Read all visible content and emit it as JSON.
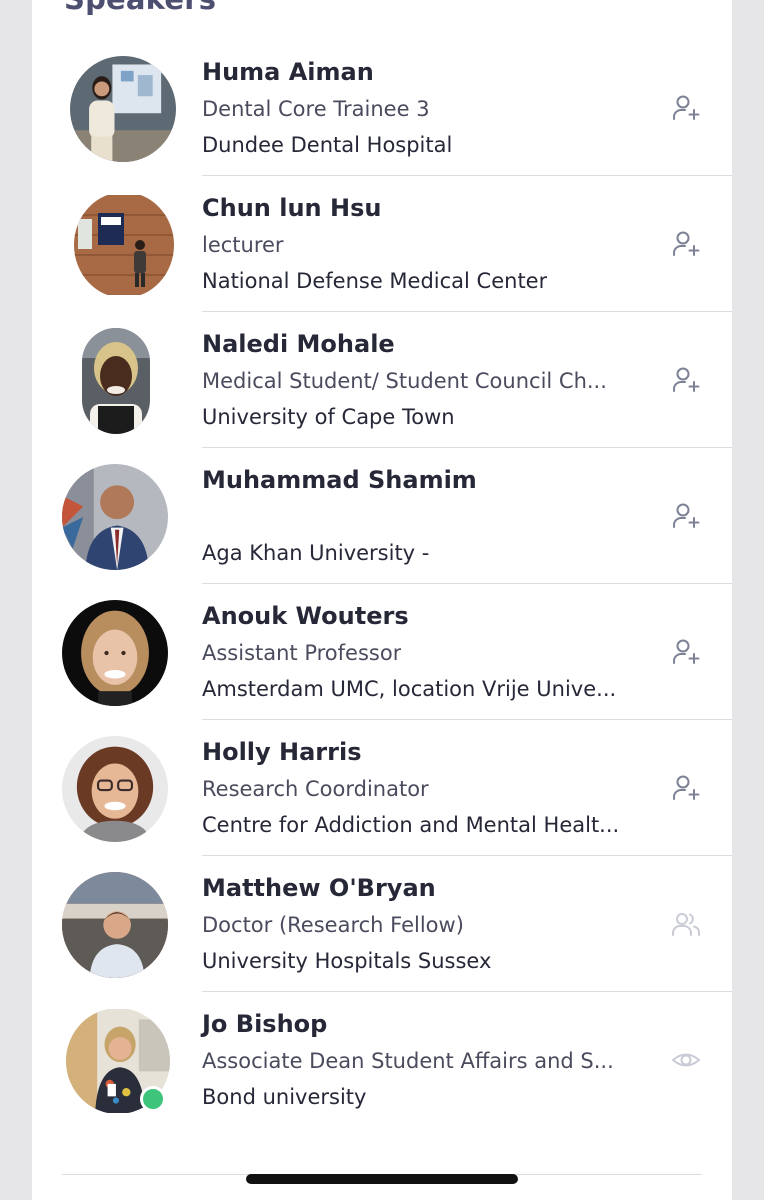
{
  "section": {
    "title": "Speakers"
  },
  "colors": {
    "accent": "#4d4f70",
    "icon": "#7c8196",
    "icon_muted": "#c9ccd6",
    "online": "#3ec47b"
  },
  "speakers": [
    {
      "name": "Huma Aiman",
      "title": "Dental Core Trainee 3",
      "org": "Dundee Dental Hospital",
      "action_icon": "add-contact-icon"
    },
    {
      "name": "Chun lun Hsu",
      "title": "lecturer",
      "org": "National Defense Medical Center",
      "action_icon": "add-contact-icon"
    },
    {
      "name": "Naledi Mohale",
      "title": "Medical Student/ Student Council Ch...",
      "org": "University of Cape Town",
      "action_icon": "add-contact-icon"
    },
    {
      "name": "Muhammad Shamim",
      "title": "",
      "org": "Aga Khan University -",
      "action_icon": "add-contact-icon"
    },
    {
      "name": "Anouk Wouters",
      "title": "Assistant Professor",
      "org": "Amsterdam UMC, location Vrije Unive...",
      "action_icon": "add-contact-icon"
    },
    {
      "name": "Holly Harris",
      "title": "Research Coordinator",
      "org": "Centre for Addiction and Mental Healt...",
      "action_icon": "add-contact-icon"
    },
    {
      "name": "Matthew O'Bryan",
      "title": "Doctor (Research Fellow)",
      "org": "University Hospitals Sussex",
      "action_icon": "contacts-icon"
    },
    {
      "name": "Jo Bishop",
      "title": "Associate Dean Student Affairs and S...",
      "org": "Bond university",
      "action_icon": "eye-icon",
      "online": true
    }
  ]
}
